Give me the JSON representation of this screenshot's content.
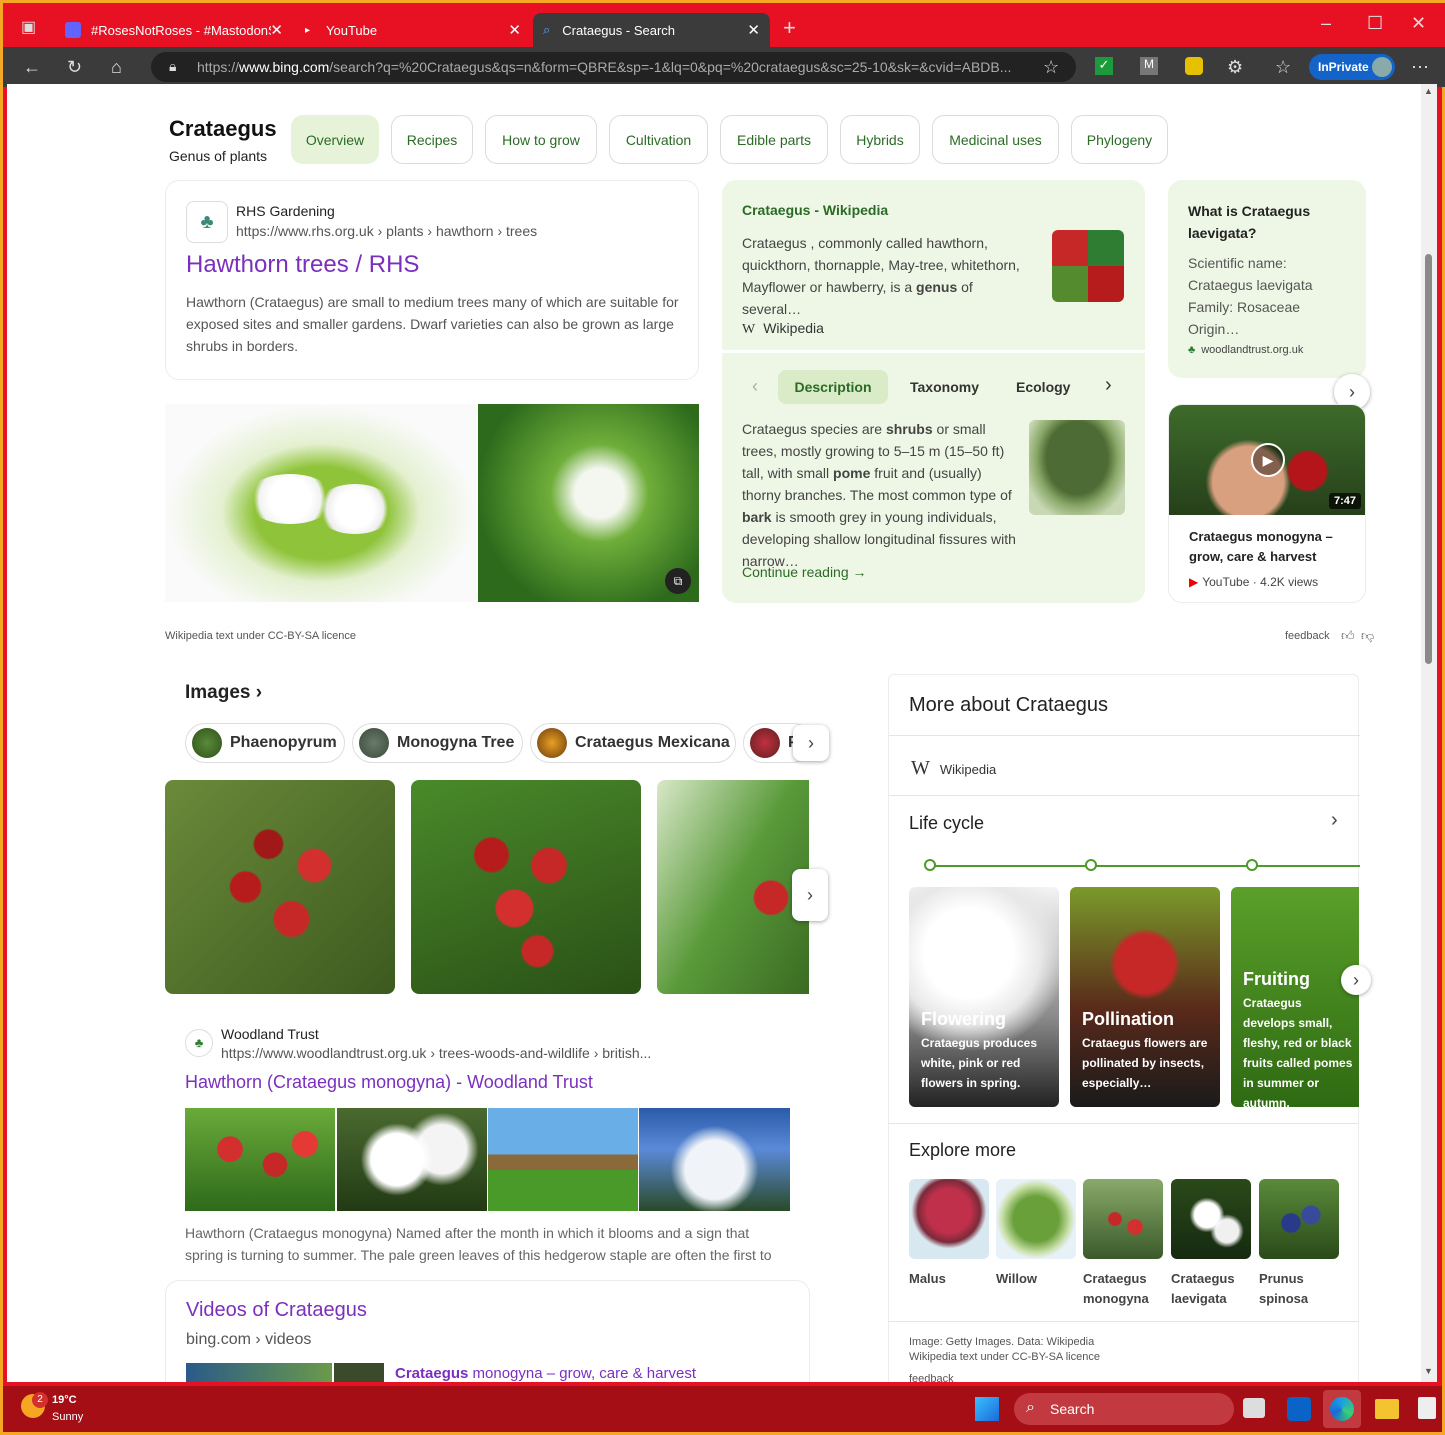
{
  "browser": {
    "tabs": [
      {
        "label": "#RosesNotRoses - #MastodonSpy"
      },
      {
        "label": "YouTube"
      },
      {
        "label": "Crataegus - Search"
      }
    ],
    "url_prefix": "https://",
    "url_domain": "www.bing.com",
    "url_rest": "/search?q=%20Crataegus&qs=n&form=QBRE&sp=-1&lq=0&pq=%20crataegus&sc=25-10&sk=&cvid=ABDB...",
    "inprivate": "InPrivate"
  },
  "header": {
    "title": "Crataegus",
    "subtitle": "Genus of plants",
    "tabs": [
      "Overview",
      "Recipes",
      "How to grow",
      "Cultivation",
      "Edible parts",
      "Hybrids",
      "Medicinal uses",
      "Phylogeny"
    ]
  },
  "rhs": {
    "site": "RHS Gardening",
    "url": "https://www.rhs.org.uk › plants › hawthorn › trees",
    "title": "Hawthorn trees / RHS",
    "snippet": "Hawthorn (Crataegus) are small to medium trees many of which are suitable for exposed sites and smaller gardens. Dwarf varieties can also be grown as large shrubs in borders."
  },
  "wiki": {
    "heading": "Crataegus - Wikipedia",
    "intro_a": "Crataegus , commonly called hawthorn, quickthorn, thornapple, May-tree, whitethorn, Mayflower or hawberry, is a ",
    "intro_b": "genus",
    "intro_c": " of several…",
    "source": "Wikipedia",
    "tabs": [
      "Description",
      "Taxonomy",
      "Ecology"
    ],
    "desc": [
      "Crataegus species are ",
      "shrubs",
      " or small trees, mostly growing to 5–15 m (15–50 ft) tall, with small ",
      "pome",
      " fruit and (usually) thorny branches. The most common type of ",
      "bark",
      " is smooth grey in young individuals, developing shallow longitudinal fissures with narrow…"
    ],
    "continue": "Continue reading →"
  },
  "faq": {
    "title": "What is Crataegus laevigata?",
    "body": "Scientific name: Crataegus laevigata Family: Rosaceae Origin…",
    "source": "woodlandtrust.org.uk"
  },
  "video": {
    "duration": "7:47",
    "title": "Crataegus monogyna – grow, care & harvest",
    "source": "YouTube",
    "views": "4.2K views"
  },
  "licence": "Wikipedia text under CC-BY-SA licence",
  "feedback": "feedback",
  "images": {
    "heading": "Images ›",
    "chips": [
      "Phaenopyrum",
      "Monogyna Tree",
      "Crataegus Mexicana",
      "P"
    ]
  },
  "woodland": {
    "site": "Woodland Trust",
    "url": "https://www.woodlandtrust.org.uk › trees-woods-and-wildlife › british...",
    "title": "Hawthorn (Crataegus monogyna) - Woodland Trust",
    "snippet": "Hawthorn (Crataegus monogyna) Named after the month in which it blooms and a sign that spring is turning to summer. The pale green leaves of this hedgerow staple are often the first to …"
  },
  "videos": {
    "title": "Videos of Crataegus",
    "url": "bing.com › videos",
    "item_bold": "Crataegus",
    "item_rest": " monogyna – grow, care & harvest"
  },
  "more": {
    "title": "More about Crataegus",
    "wiki": "Wikipedia",
    "lifecycle": "Life cycle",
    "stages": [
      {
        "name": "Flowering",
        "text": "Crataegus produces white, pink or red flowers in spring."
      },
      {
        "name": "Pollination",
        "text": "Crataegus flowers are pollinated by insects, especially…"
      },
      {
        "name": "Fruiting",
        "text": "Crataegus develops small, fleshy, red or black fruits called pomes in summer or autumn."
      }
    ],
    "explore": "Explore more",
    "explore_items": [
      "Malus",
      "Willow",
      "Crataegus monogyna",
      "Crataegus laevigata",
      "Prunus spinosa"
    ],
    "credit1": "Image: Getty Images. Data: Wikipedia",
    "credit2": "Wikipedia text under CC-BY-SA licence",
    "feedback": "feedback"
  },
  "taskbar": {
    "temp": "19°C",
    "weather": "Sunny",
    "badge": "2",
    "search": "Search"
  }
}
